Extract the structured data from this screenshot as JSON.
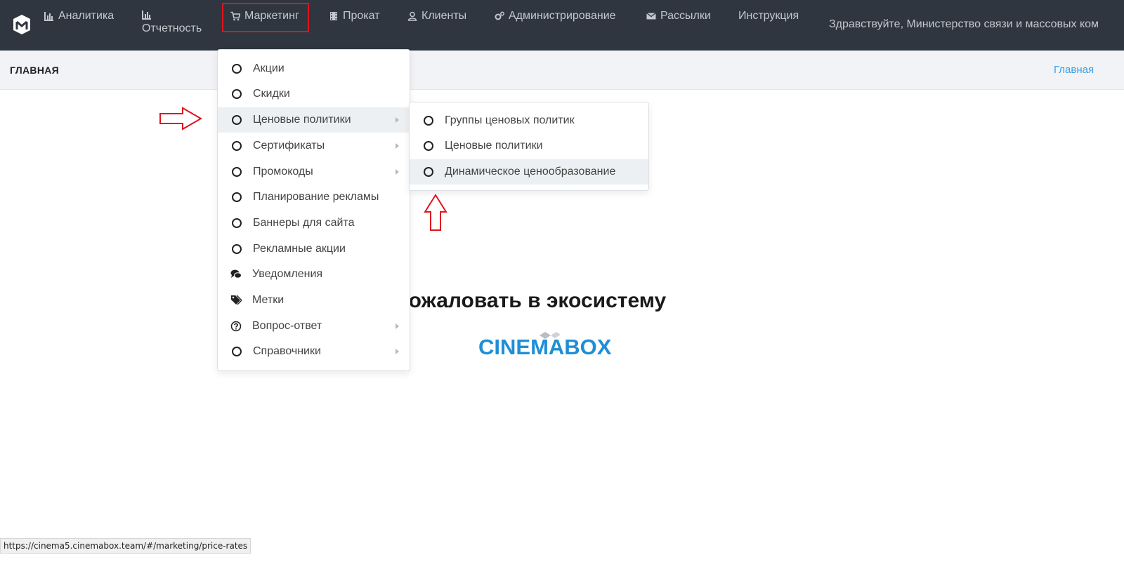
{
  "nav": {
    "logo": "cinemabox-logo",
    "items": [
      {
        "label": "Аналитика",
        "icon": "bar-chart-icon"
      },
      {
        "label": "Отчетность",
        "icon": "bar-chart-icon"
      },
      {
        "label": "Маркетинг",
        "icon": "cart-icon",
        "active": true
      },
      {
        "label": "Прокат",
        "icon": "film-icon"
      },
      {
        "label": "Клиенты",
        "icon": "user-icon"
      },
      {
        "label": "Администрирование",
        "icon": "gears-icon"
      },
      {
        "label": "Рассылки",
        "icon": "envelope-icon"
      },
      {
        "label": "Инструкция",
        "icon": ""
      }
    ],
    "greeting": "Здравствуйте, Министерство связи и массовых ком"
  },
  "subheader": {
    "title": "ГЛАВНАЯ",
    "breadcrumb": "Главная"
  },
  "marketing_menu": {
    "items": [
      {
        "label": "Акции",
        "icon": "circle-icon"
      },
      {
        "label": "Скидки",
        "icon": "circle-icon"
      },
      {
        "label": "Ценовые политики",
        "icon": "circle-icon",
        "submenu": true,
        "highlighted": true
      },
      {
        "label": "Сертификаты",
        "icon": "circle-icon",
        "submenu": true
      },
      {
        "label": "Промокоды",
        "icon": "circle-icon",
        "submenu": true
      },
      {
        "label": "Планирование рекламы",
        "icon": "circle-icon"
      },
      {
        "label": "Баннеры для сайта",
        "icon": "circle-icon"
      },
      {
        "label": "Рекламные акции",
        "icon": "circle-icon"
      },
      {
        "label": "Уведомления",
        "icon": "comments-icon"
      },
      {
        "label": "Метки",
        "icon": "tags-icon"
      },
      {
        "label": "Вопрос-ответ",
        "icon": "question-circle-icon",
        "submenu": true
      },
      {
        "label": "Справочники",
        "icon": "circle-icon",
        "submenu": true
      }
    ]
  },
  "price_policies_submenu": {
    "items": [
      {
        "label": "Группы ценовых политик",
        "icon": "circle-icon"
      },
      {
        "label": "Ценовые политики",
        "icon": "circle-icon"
      },
      {
        "label": "Динамическое ценообразование",
        "icon": "circle-icon",
        "highlighted": true
      }
    ]
  },
  "main": {
    "welcome": "бро пожаловать в экосистему",
    "brand": "CINEMABOX"
  },
  "status_bar": {
    "url": "https://cinema5.cinemabox.team/#/marketing/price-rates"
  },
  "colors": {
    "nav_bg": "#2f3640",
    "annotation_red": "#e0141e",
    "brand_blue": "#1e8fd6",
    "link": "#3aa0e6"
  }
}
